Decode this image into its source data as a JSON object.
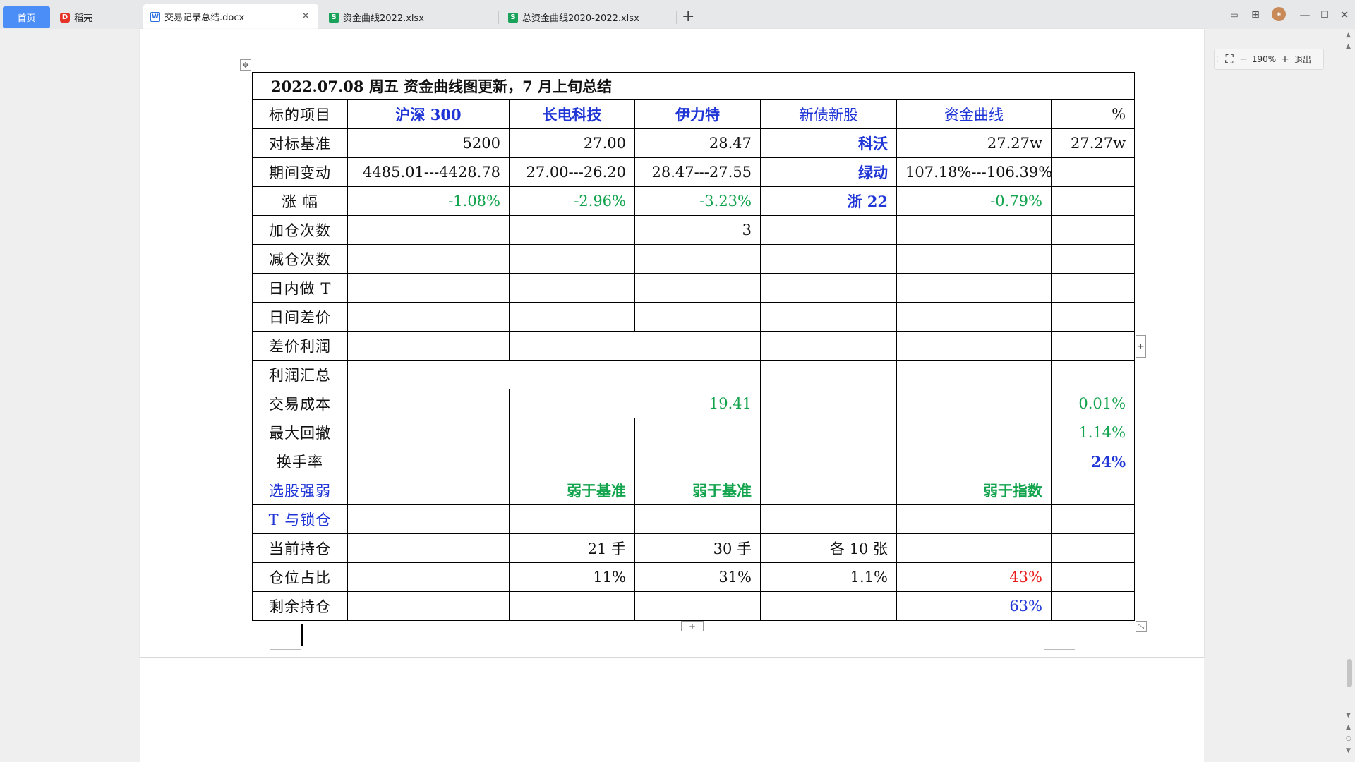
{
  "tabs": {
    "home": "首页",
    "daoke": "稻壳",
    "active_doc": "交易记录总结.docx",
    "xlsx1": "资金曲线2022.xlsx",
    "xlsx2": "总资金曲线2020-2022.xlsx"
  },
  "zoom": {
    "level": "190%",
    "exit": "退出"
  },
  "table": {
    "title": "2022.07.08  周五  资金曲线图更新，7 月上旬总结",
    "header": [
      "标的项目",
      "沪深 300",
      "长电科技",
      "伊力特",
      "新债新股",
      "资金曲线",
      "%"
    ],
    "rows": {
      "benchmark": {
        "label": "对标基准",
        "hs300": "5200",
        "cd": "27.00",
        "ylt": "28.47",
        "bond_name": "科沃",
        "fund": "27.27w",
        "pct": "27.27w"
      },
      "change": {
        "label": "期间变动",
        "hs300": "4485.01---4428.78",
        "cd": "27.00---26.20",
        "ylt": "28.47---27.55",
        "bond_name": "绿动",
        "fund": "107.18%---106.39%"
      },
      "rise": {
        "label": "涨  幅",
        "hs300": "-1.08%",
        "cd": "-2.96%",
        "ylt": "-3.23%",
        "bond_name": "浙 22",
        "fund": "-0.79%"
      },
      "add": {
        "label": "加仓次数",
        "ylt": "3"
      },
      "reduce": {
        "label": "减仓次数"
      },
      "intraday": {
        "label": "日内做 T"
      },
      "interday": {
        "label": "日间差价"
      },
      "spread_profit": {
        "label": "差价利润"
      },
      "profit_sum": {
        "label": "利润汇总"
      },
      "cost": {
        "label": "交易成本",
        "cd_ylt": "19.41",
        "pct": "0.01%"
      },
      "drawdown": {
        "label": "最大回撤",
        "pct": "1.14%"
      },
      "turnover": {
        "label": "换手率",
        "pct": "24%"
      },
      "strength": {
        "label": "选股强弱",
        "cd": "弱于基准",
        "ylt": "弱于基准",
        "fund": "弱于指数"
      },
      "tlock": {
        "label": "T 与锁仓"
      },
      "holding": {
        "label": "当前持仓",
        "cd": "21 手",
        "ylt": "30 手",
        "bond": "各 10 张"
      },
      "ratio": {
        "label": "仓位占比",
        "cd": "11%",
        "ylt": "31%",
        "bond": "1.1%",
        "fund": "43%"
      },
      "remaining": {
        "label": "剩余持仓",
        "fund": "63%"
      }
    }
  },
  "colors": {
    "blue": "#1f35d6",
    "green": "#12a34d",
    "red": "#e81a1a",
    "home_tab": "#4c8ef7"
  }
}
